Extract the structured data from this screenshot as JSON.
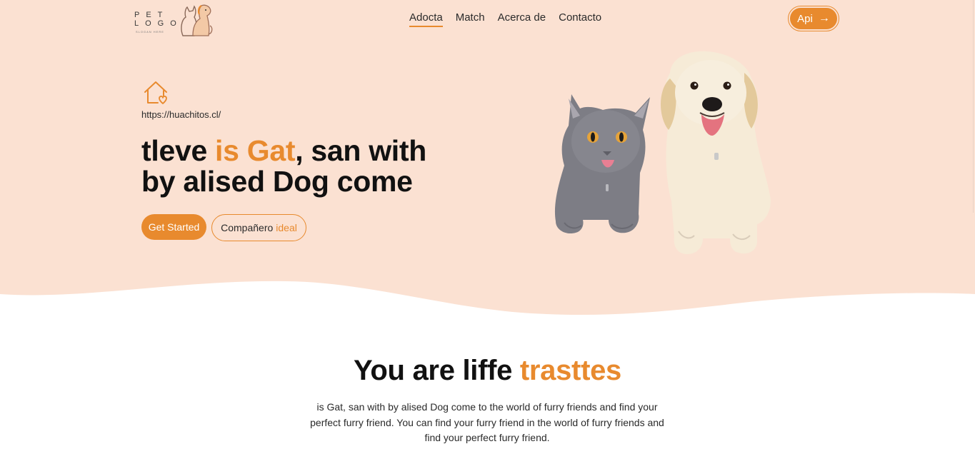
{
  "colors": {
    "accent": "#e88a2e",
    "hero_bg": "#fbe1d2",
    "text": "#111111"
  },
  "logo": {
    "line1": "PET",
    "line2": "LOGO",
    "tagline": "SLOGAN HERE",
    "icon": "cat-and-dog-logo-icon"
  },
  "nav": {
    "items": [
      {
        "label": "Adocta",
        "active": true
      },
      {
        "label": "Match"
      },
      {
        "label": "Acerca de"
      },
      {
        "label": "Contacto"
      }
    ]
  },
  "header": {
    "api_label": "Api",
    "api_icon": "arrow-right-icon"
  },
  "hero": {
    "icon": "home-heart-icon",
    "url": "https://huachitos.cl/",
    "title_part1": "tleve ",
    "title_accent": "is Gat",
    "title_part2": ", san with",
    "title_line2": "by alised Dog come",
    "primary_button": "Get Started",
    "secondary_button_text": "Compañero",
    "secondary_button_accent": "ideal",
    "image": "cat-and-dog-photo"
  },
  "section": {
    "title_part1": "You are liffe ",
    "title_accent": "trasttes",
    "body": "is Gat, san with by alised Dog come to the world of furry friends and find your perfect furry friend. You can find your furry friend in the world of furry friends and find your perfect furry friend."
  }
}
